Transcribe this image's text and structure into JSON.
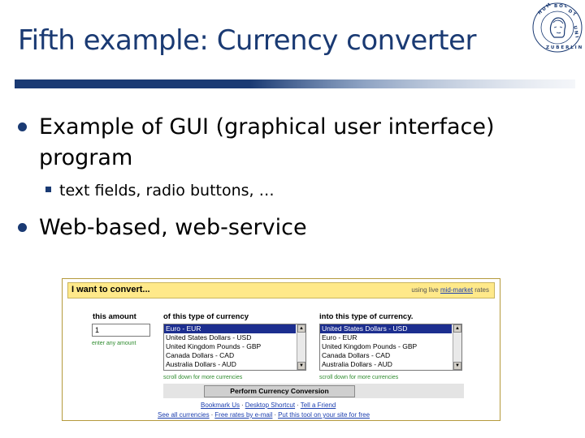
{
  "slide": {
    "title": "Fifth example: Currency converter",
    "bullets": [
      {
        "line1": "Example of GUI (graphical user interface)",
        "line2": "program"
      },
      {
        "line1": "Web-based, web-service"
      }
    ],
    "sub_bullet": "text fields, radio buttons, …"
  },
  "colors": {
    "title": "#1a3a73",
    "accent_band": "#1a3a73",
    "header_bg": "#ffe98a",
    "selected_item": "#1c2e8f",
    "link": "#1b3eaf",
    "hint": "#2e8b2e"
  },
  "converter": {
    "header_title": "I want to convert...",
    "header_right_prefix": "using live ",
    "header_right_link": "mid-market",
    "header_right_suffix": " rates",
    "amount_label": "this amount",
    "amount_value": "1",
    "amount_hint": "enter any amount",
    "from_label": "of this type of currency",
    "to_label": "into this type of currency.",
    "from_options": [
      "Euro - EUR",
      "United States Dollars - USD",
      "United Kingdom Pounds - GBP",
      "Canada Dollars - CAD",
      "Australia Dollars - AUD"
    ],
    "from_selected": "Euro - EUR",
    "to_options": [
      "United States Dollars - USD",
      "Euro - EUR",
      "United Kingdom Pounds - GBP",
      "Canada Dollars - CAD",
      "Australia Dollars - AUD"
    ],
    "to_selected": "United States Dollars - USD",
    "scroll_hint": "scroll down for more currencies",
    "perform_button": "Perform Currency Conversion",
    "links_row1": [
      "Bookmark Us",
      "Desktop Shortcut",
      "Tell a Friend"
    ],
    "links_row2": [
      "See all currencies",
      "Free rates by e-mail",
      "Put this tool on your site for free"
    ]
  }
}
